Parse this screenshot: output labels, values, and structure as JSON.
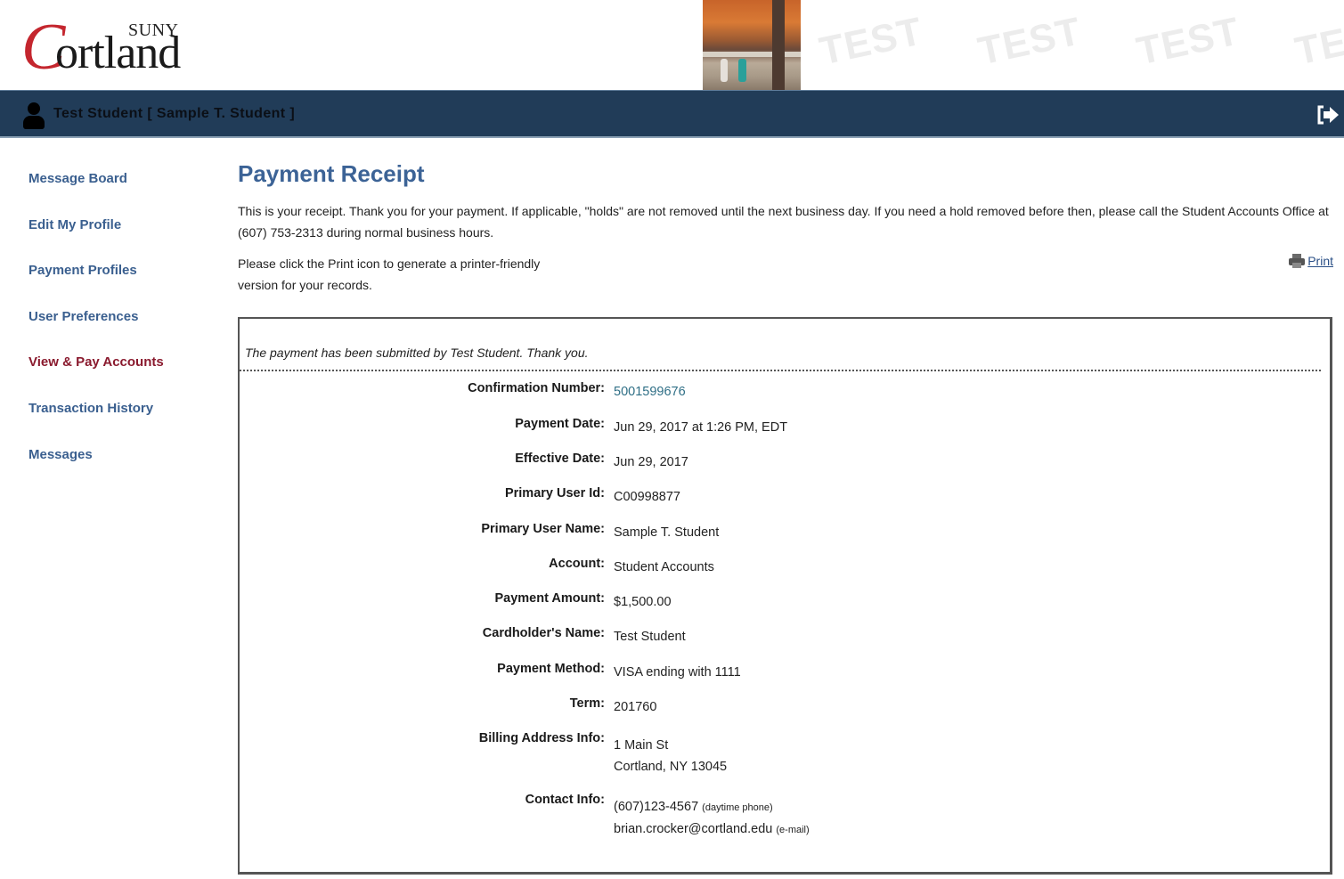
{
  "header": {
    "logo": {
      "c_letter": "C",
      "suny": "SUNY",
      "ortland": "ortland"
    },
    "watermark_text": "TEST"
  },
  "topbar": {
    "user_display": "Test Student [ Sample T. Student ]"
  },
  "sidebar": {
    "items": [
      {
        "label": "Message Board",
        "active": false
      },
      {
        "label": "Edit My Profile",
        "active": false
      },
      {
        "label": "Payment Profiles",
        "active": false
      },
      {
        "label": "User Preferences",
        "active": false
      },
      {
        "label": "View & Pay Accounts",
        "active": true
      },
      {
        "label": "Transaction History",
        "active": false
      },
      {
        "label": "Messages",
        "active": false
      }
    ]
  },
  "main": {
    "title": "Payment Receipt",
    "intro": "This is your receipt. Thank you for your payment. If applicable, \"holds\" are not removed until the next business day. If you need a hold removed before then, please call the Student Accounts Office at (607) 753-2313 during normal business hours.",
    "print_instructions": "Please click the Print icon to generate a printer-friendly version for your records.",
    "print_label": "Print"
  },
  "receipt": {
    "submitted_message": "The payment has been submitted by Test Student. Thank you.",
    "fields": [
      {
        "label": "Confirmation Number:",
        "value": "5001599676"
      },
      {
        "label": "Payment Date:",
        "value": "Jun 29, 2017 at 1:26 PM, EDT"
      },
      {
        "label": "Effective Date:",
        "value": "Jun 29, 2017"
      },
      {
        "label": "Primary User Id:",
        "value": "C00998877"
      },
      {
        "label": "Primary User Name:",
        "value": "Sample T. Student"
      },
      {
        "label": "Account:",
        "value": "Student Accounts"
      },
      {
        "label": "Payment Amount:",
        "value": "$1,500.00"
      },
      {
        "label": "Cardholder's Name:",
        "value": "Test Student"
      },
      {
        "label": "Payment Method:",
        "value": "VISA ending with 1111"
      },
      {
        "label": "Term:",
        "value": "201760"
      }
    ],
    "billing": {
      "label": "Billing Address Info:",
      "line1": "1 Main St",
      "line2": "Cortland, NY 13045"
    },
    "contact": {
      "label": "Contact Info:",
      "phone": "(607)123-4567",
      "phone_note": "(daytime phone)",
      "email": "brian.crocker@cortland.edu",
      "email_note": "(e-mail)"
    }
  },
  "colors": {
    "topbar": "#213c58",
    "link": "#3a5f8f",
    "active_link": "#8a1a2e",
    "title": "#3c6396",
    "logo_red": "#c4262e"
  }
}
